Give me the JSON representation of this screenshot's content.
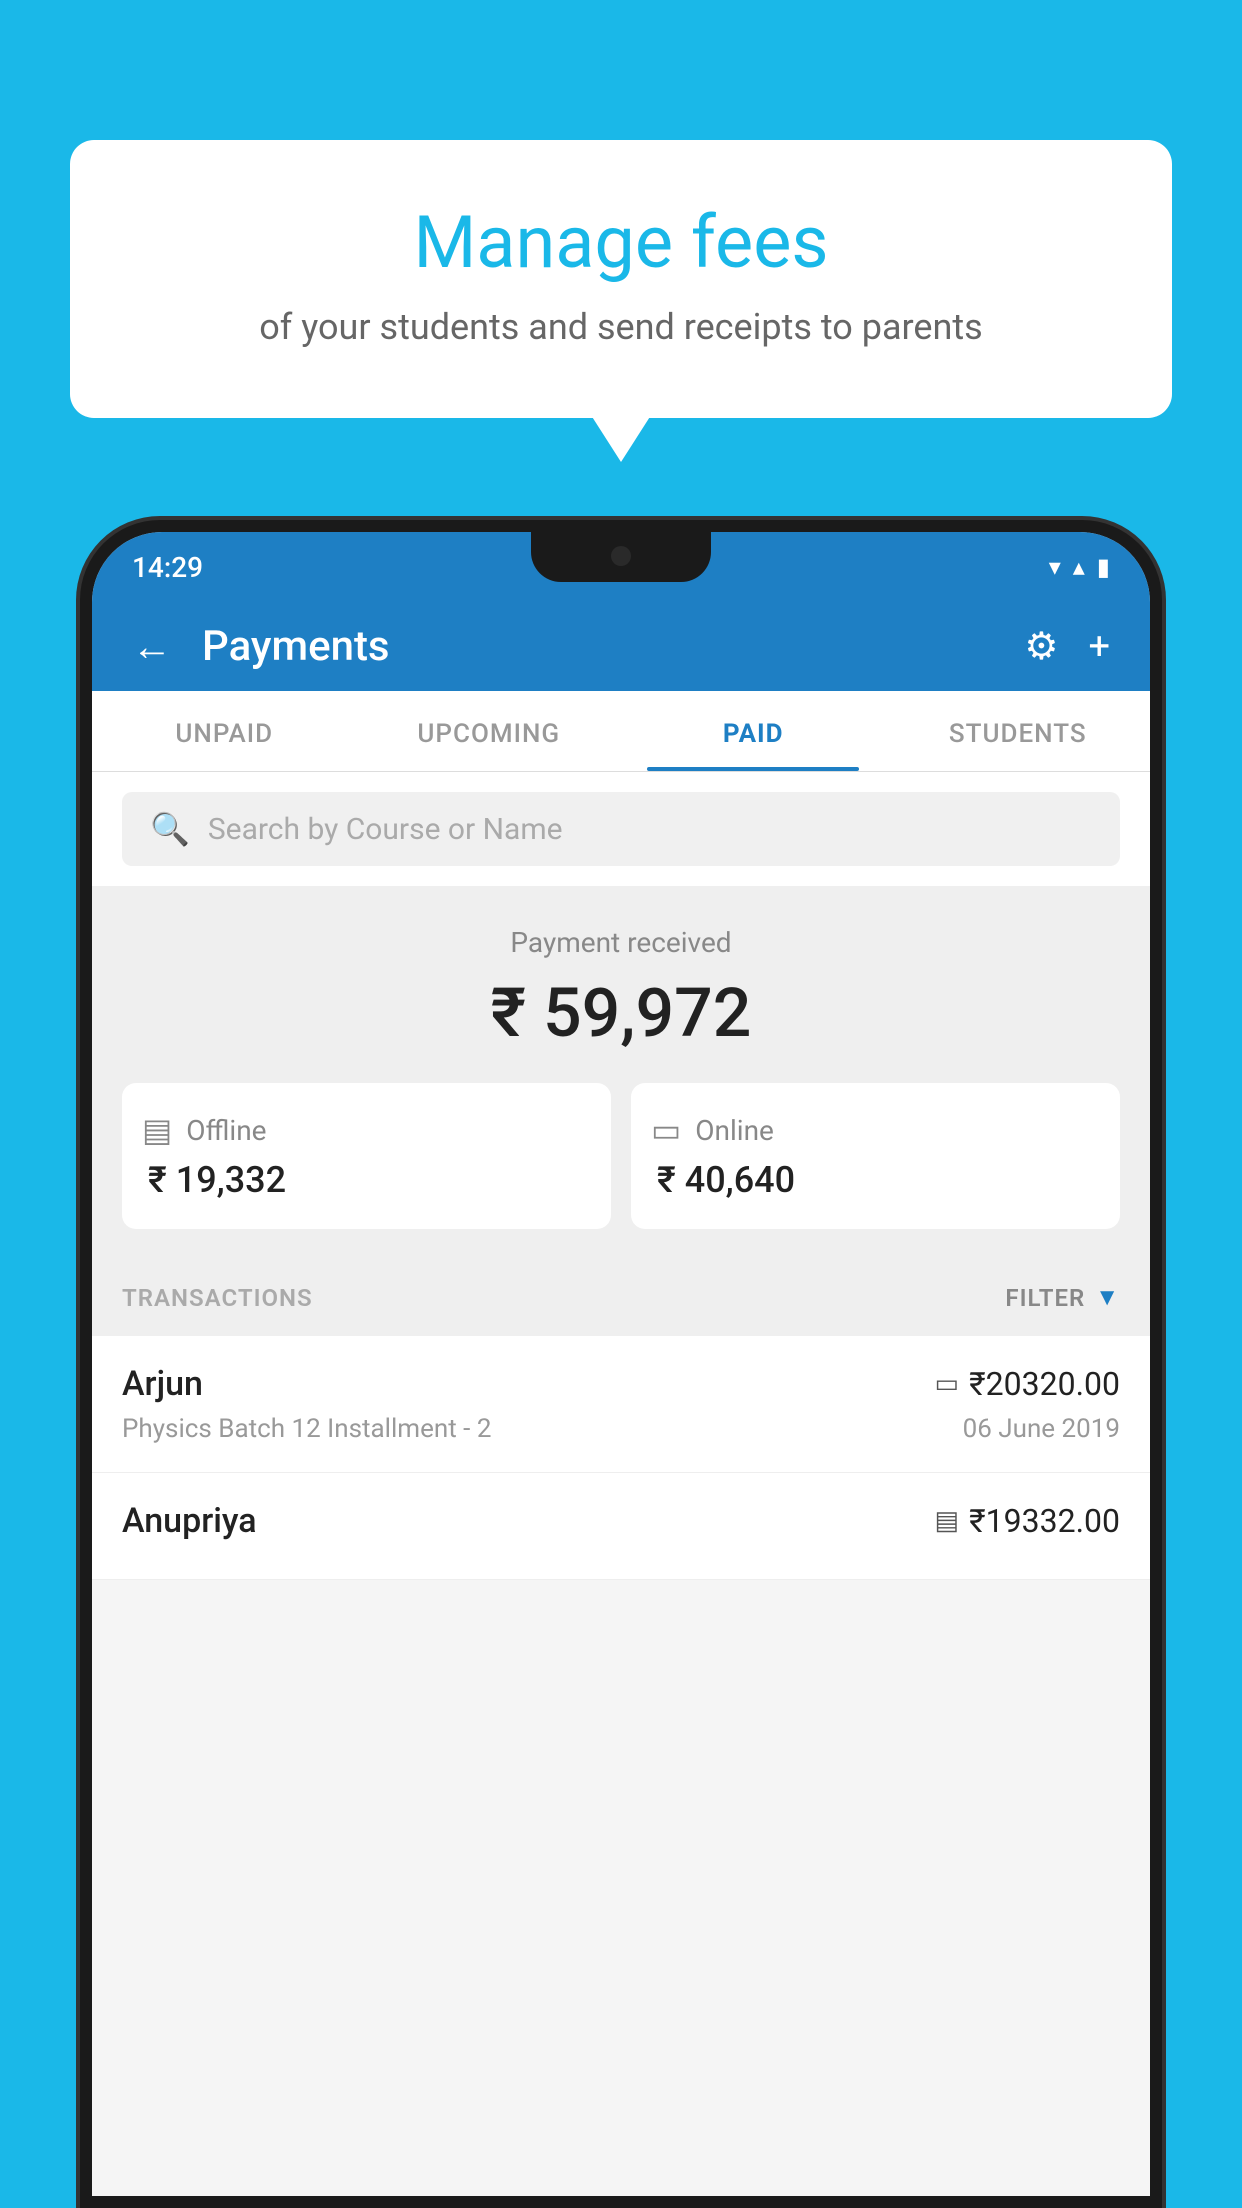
{
  "background": {
    "color": "#1ab8e8"
  },
  "speech_bubble": {
    "title": "Manage fees",
    "subtitle": "of your students and send receipts to parents"
  },
  "status_bar": {
    "time": "14:29",
    "wifi_icon": "▼",
    "signal_icon": "▲",
    "battery_icon": "▮"
  },
  "header": {
    "title": "Payments",
    "back_label": "←",
    "settings_label": "⚙",
    "add_label": "+"
  },
  "tabs": [
    {
      "label": "UNPAID",
      "active": false
    },
    {
      "label": "UPCOMING",
      "active": false
    },
    {
      "label": "PAID",
      "active": true
    },
    {
      "label": "STUDENTS",
      "active": false
    }
  ],
  "search": {
    "placeholder": "Search by Course or Name"
  },
  "payment_summary": {
    "label": "Payment received",
    "total": "₹ 59,972",
    "offline": {
      "type": "Offline",
      "amount": "₹ 19,332",
      "icon": "▤"
    },
    "online": {
      "type": "Online",
      "amount": "₹ 40,640",
      "icon": "▭"
    }
  },
  "transactions": {
    "label": "TRANSACTIONS",
    "filter_label": "FILTER",
    "filter_icon": "▼",
    "items": [
      {
        "name": "Arjun",
        "amount": "₹20320.00",
        "course": "Physics Batch 12 Installment - 2",
        "date": "06 June 2019",
        "payment_icon": "▭"
      },
      {
        "name": "Anupriya",
        "amount": "₹19332.00",
        "course": "",
        "date": "",
        "payment_icon": "▤"
      }
    ]
  }
}
